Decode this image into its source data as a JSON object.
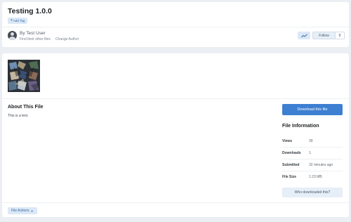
{
  "header": {
    "title": "Testing 1.0.0",
    "add_tag_label": "Add Tag",
    "author_line": "By Test User",
    "find_files_link": "Find their other files",
    "change_author_link": "Change Author",
    "follow_label": "Follow",
    "follow_count": "0"
  },
  "file": {
    "about_heading": "About This File",
    "description": "This is a test.",
    "download_label": "Download this file",
    "info_heading": "File Information",
    "info": [
      {
        "label": "Views",
        "value": "39"
      },
      {
        "label": "Downloads",
        "value": "1"
      },
      {
        "label": "Submitted",
        "value": "32 minutes ago"
      },
      {
        "label": "File Size",
        "value": "1.23 MB"
      }
    ],
    "who_downloaded_label": "Who downloaded this?",
    "file_actions_label": "File Actions"
  },
  "colors": {
    "accent": "#3d7fd1",
    "light_button": "#dbe8f6",
    "page_bg": "#ebeef2"
  }
}
